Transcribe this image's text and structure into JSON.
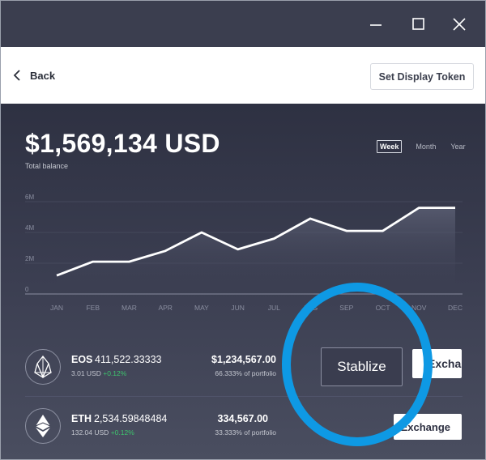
{
  "window": {
    "controls": [
      "minimize-icon",
      "maximize-icon",
      "close-icon"
    ]
  },
  "header": {
    "back_label": "Back",
    "set_display_token": "Set Display Token"
  },
  "balance": {
    "amount": "$1,569,134 USD",
    "label": "Total balance"
  },
  "periods": {
    "week": "Week",
    "month": "Month",
    "year": "Year",
    "selected": "Week"
  },
  "chart_data": {
    "type": "area",
    "title": "",
    "xlabel": "",
    "ylabel": "",
    "categories": [
      "JAN",
      "FEB",
      "MAR",
      "APR",
      "MAY",
      "JUN",
      "JUL",
      "AUG",
      "SEP",
      "OCT",
      "NOV",
      "DEC"
    ],
    "values": [
      1.2,
      2.1,
      2.1,
      2.8,
      4.0,
      2.9,
      3.6,
      4.9,
      4.1,
      4.1,
      5.6,
      5.6
    ],
    "y_ticks": [
      "0",
      "2M",
      "4M",
      "6M"
    ],
    "ylim": [
      0,
      6
    ],
    "grid": true,
    "line_color": "#ffffff"
  },
  "tokens": [
    {
      "symbol": "EOS",
      "amount": "411,522.33333",
      "price": "3.01 USD",
      "change": "+0.12%",
      "value": "$1,234,567.00",
      "portfolio": "66.333% of portfolio",
      "icon": "eos-icon",
      "action_label": "Exchange"
    },
    {
      "symbol": "ETH",
      "amount": "2,534.59848484",
      "price": "132.04 USD",
      "change": "+0.12%",
      "value": "334,567.00",
      "portfolio": "33.333% of portfolio",
      "icon": "eth-icon",
      "action_label": "Exchange"
    }
  ],
  "stabilize_label": "Stablize",
  "colors": {
    "titlebar": "#3b3e4f",
    "panel": "#2e3142",
    "positive": "#3ec46d",
    "highlight_ring": "#0e99e4"
  }
}
